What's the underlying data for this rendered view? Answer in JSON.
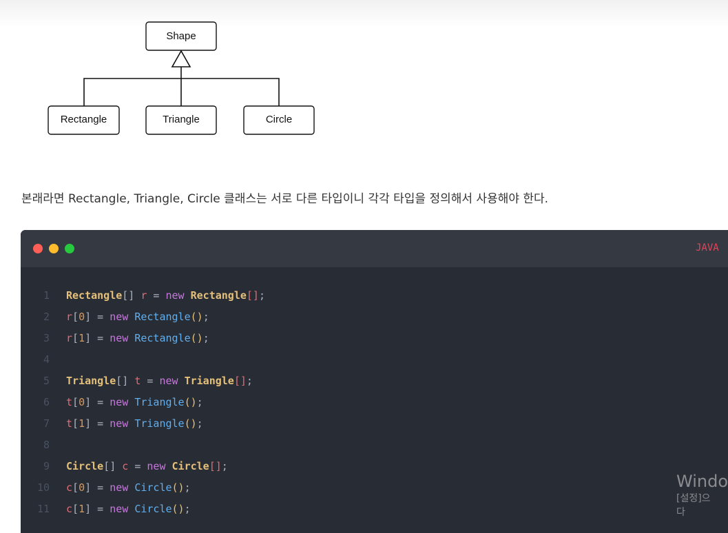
{
  "diagram": {
    "parent": "Shape",
    "children": [
      "Rectangle",
      "Triangle",
      "Circle"
    ]
  },
  "paragraph": "본래라면 Rectangle, Triangle, Circle 클래스는 서로 다른 타입이니 각각 타입을 정의해서 사용해야 한다.",
  "code_block": {
    "language": "JAVA",
    "lines": [
      [
        [
          "class",
          "Rectangle"
        ],
        [
          "punct",
          "[] "
        ],
        [
          "var",
          "r"
        ],
        [
          "punct",
          " = "
        ],
        [
          "kw",
          "new "
        ],
        [
          "class",
          "Rectangle"
        ],
        [
          "var",
          "[]"
        ],
        [
          "punct",
          ";"
        ]
      ],
      [
        [
          "var",
          "r"
        ],
        [
          "punct",
          "["
        ],
        [
          "num",
          "0"
        ],
        [
          "punct",
          "] = "
        ],
        [
          "kw",
          "new "
        ],
        [
          "call",
          "Rectangle"
        ],
        [
          "paren",
          "()"
        ],
        [
          "punct",
          ";"
        ]
      ],
      [
        [
          "var",
          "r"
        ],
        [
          "punct",
          "["
        ],
        [
          "num",
          "1"
        ],
        [
          "punct",
          "] = "
        ],
        [
          "kw",
          "new "
        ],
        [
          "call",
          "Rectangle"
        ],
        [
          "paren",
          "()"
        ],
        [
          "punct",
          ";"
        ]
      ],
      [],
      [
        [
          "class",
          "Triangle"
        ],
        [
          "punct",
          "[] "
        ],
        [
          "var",
          "t"
        ],
        [
          "punct",
          " = "
        ],
        [
          "kw",
          "new "
        ],
        [
          "class",
          "Triangle"
        ],
        [
          "var",
          "[]"
        ],
        [
          "punct",
          ";"
        ]
      ],
      [
        [
          "var",
          "t"
        ],
        [
          "punct",
          "["
        ],
        [
          "num",
          "0"
        ],
        [
          "punct",
          "] = "
        ],
        [
          "kw",
          "new "
        ],
        [
          "call",
          "Triangle"
        ],
        [
          "paren",
          "()"
        ],
        [
          "punct",
          ";"
        ]
      ],
      [
        [
          "var",
          "t"
        ],
        [
          "punct",
          "["
        ],
        [
          "num",
          "1"
        ],
        [
          "punct",
          "] = "
        ],
        [
          "kw",
          "new "
        ],
        [
          "call",
          "Triangle"
        ],
        [
          "paren",
          "()"
        ],
        [
          "punct",
          ";"
        ]
      ],
      [],
      [
        [
          "class",
          "Circle"
        ],
        [
          "punct",
          "[] "
        ],
        [
          "var",
          "c"
        ],
        [
          "punct",
          " = "
        ],
        [
          "kw",
          "new "
        ],
        [
          "class",
          "Circle"
        ],
        [
          "var",
          "[]"
        ],
        [
          "punct",
          ";"
        ]
      ],
      [
        [
          "var",
          "c"
        ],
        [
          "punct",
          "["
        ],
        [
          "num",
          "0"
        ],
        [
          "punct",
          "] = "
        ],
        [
          "kw",
          "new "
        ],
        [
          "call",
          "Circle"
        ],
        [
          "paren",
          "()"
        ],
        [
          "punct",
          ";"
        ]
      ],
      [
        [
          "var",
          "c"
        ],
        [
          "punct",
          "["
        ],
        [
          "num",
          "1"
        ],
        [
          "punct",
          "] = "
        ],
        [
          "kw",
          "new "
        ],
        [
          "call",
          "Circle"
        ],
        [
          "paren",
          "()"
        ],
        [
          "punct",
          ";"
        ]
      ]
    ]
  },
  "watermark": {
    "title": "Windo",
    "subtitle": "[설정]으",
    "line3": "다"
  }
}
